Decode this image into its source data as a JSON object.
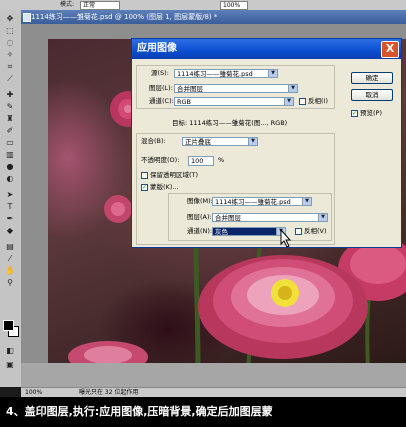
{
  "options_bar": {
    "mode_label": "模式:",
    "mode_value": "正常",
    "opacity_value": "100%"
  },
  "document": {
    "title": "1114练习——雏菊花.psd @ 100% (图层 1, 图层蒙版/8) *",
    "zoom": "100%",
    "status_text": "曝光只在 32 位起作用"
  },
  "dialog": {
    "title": "应用图像",
    "close_label": "X",
    "source_label": "源(S):",
    "source_value": "1114练习——雏菊花.psd",
    "layer_label": "图层(L):",
    "layer_value": "合并图层",
    "channel_label": "通道(C):",
    "channel_value": "RGB",
    "invert_label": "反相(I)",
    "target_text": "目标:   1114练习——雏菊花(图..., RGB)",
    "blending_label": "混合(B):",
    "blending_value": "正片叠底",
    "opacity_label": "不透明度(O):",
    "opacity_value": "100",
    "opacity_unit": "%",
    "preserve_transparency_label": "保留透明区域(T)",
    "mask_label": "蒙版(K)...",
    "mask_image_label": "图像(M):",
    "mask_image_value": "1114练习——雏菊花.psd",
    "mask_layer_label": "图层(A):",
    "mask_layer_value": "合并图层",
    "mask_channel_label": "通道(N):",
    "mask_channel_value": "灰色",
    "mask_invert_label": "反相(V)",
    "ok_label": "确定",
    "cancel_label": "取消",
    "preview_label": "预览(P)",
    "check_mark": "✓"
  },
  "caption": "4、盖印图层,执行:应用图像,压暗背景,确定后加图层蒙",
  "colors": {
    "accent": "#0a4ed0",
    "close": "#d9542c",
    "highlight": "#0a246a"
  }
}
